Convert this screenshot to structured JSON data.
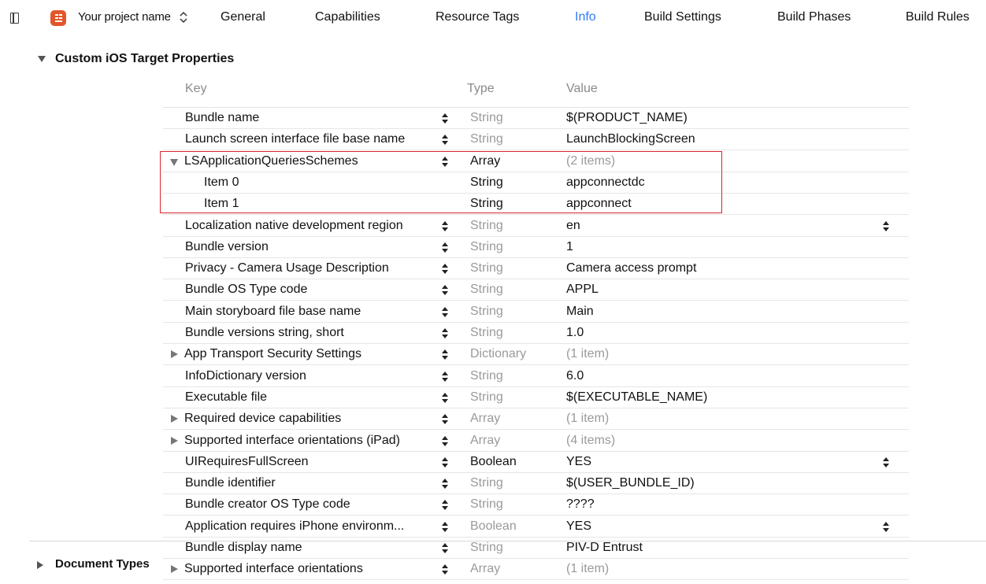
{
  "topbar": {
    "project_name": "Your project name",
    "tabs": [
      "General",
      "Capabilities",
      "Resource Tags",
      "Info",
      "Build Settings",
      "Build Phases",
      "Build Rules"
    ],
    "active_tab": "Info",
    "accent_color": "#2f7df6"
  },
  "section": {
    "title": "Custom iOS Target Properties"
  },
  "document_types": {
    "title": "Document Types"
  },
  "table": {
    "headers": {
      "key": "Key",
      "type": "Type",
      "value": "Value"
    },
    "rows": [
      {
        "key": "Bundle name",
        "type": "String",
        "value": "$(PRODUCT_NAME)"
      },
      {
        "key": "Launch screen interface file base name",
        "type": "String",
        "value": "LaunchBlockingScreen"
      },
      {
        "key": "LSApplicationQueriesSchemes",
        "type": "Array",
        "value": "(2 items)"
      },
      {
        "key": "Item 0",
        "type": "String",
        "value": "appconnectdc"
      },
      {
        "key": "Item 1",
        "type": "String",
        "value": "appconnect"
      },
      {
        "key": "Localization native development region",
        "type": "String",
        "value": "en"
      },
      {
        "key": "Bundle version",
        "type": "String",
        "value": "1"
      },
      {
        "key": "Privacy - Camera Usage Description",
        "type": "String",
        "value": "Camera access prompt"
      },
      {
        "key": "Bundle OS Type code",
        "type": "String",
        "value": "APPL"
      },
      {
        "key": "Main storyboard file base name",
        "type": "String",
        "value": "Main"
      },
      {
        "key": "Bundle versions string, short",
        "type": "String",
        "value": "1.0"
      },
      {
        "key": "App Transport Security Settings",
        "type": "Dictionary",
        "value": "(1 item)"
      },
      {
        "key": "InfoDictionary version",
        "type": "String",
        "value": "6.0"
      },
      {
        "key": "Executable file",
        "type": "String",
        "value": "$(EXECUTABLE_NAME)"
      },
      {
        "key": "Required device capabilities",
        "type": "Array",
        "value": "(1 item)"
      },
      {
        "key": "Supported interface orientations (iPad)",
        "type": "Array",
        "value": "(4 items)"
      },
      {
        "key": "UIRequiresFullScreen",
        "type": "Boolean",
        "value": "YES"
      },
      {
        "key": "Bundle identifier",
        "type": "String",
        "value": "$(USER_BUNDLE_ID)"
      },
      {
        "key": "Bundle creator OS Type code",
        "type": "String",
        "value": "????"
      },
      {
        "key": "Application requires iPhone environm...",
        "type": "Boolean",
        "value": "YES"
      },
      {
        "key": "Bundle display name",
        "type": "String",
        "value": "PIV-D Entrust"
      },
      {
        "key": "Supported interface orientations",
        "type": "Array",
        "value": "(1 item)"
      }
    ],
    "highlight_color": "#d9262c"
  }
}
